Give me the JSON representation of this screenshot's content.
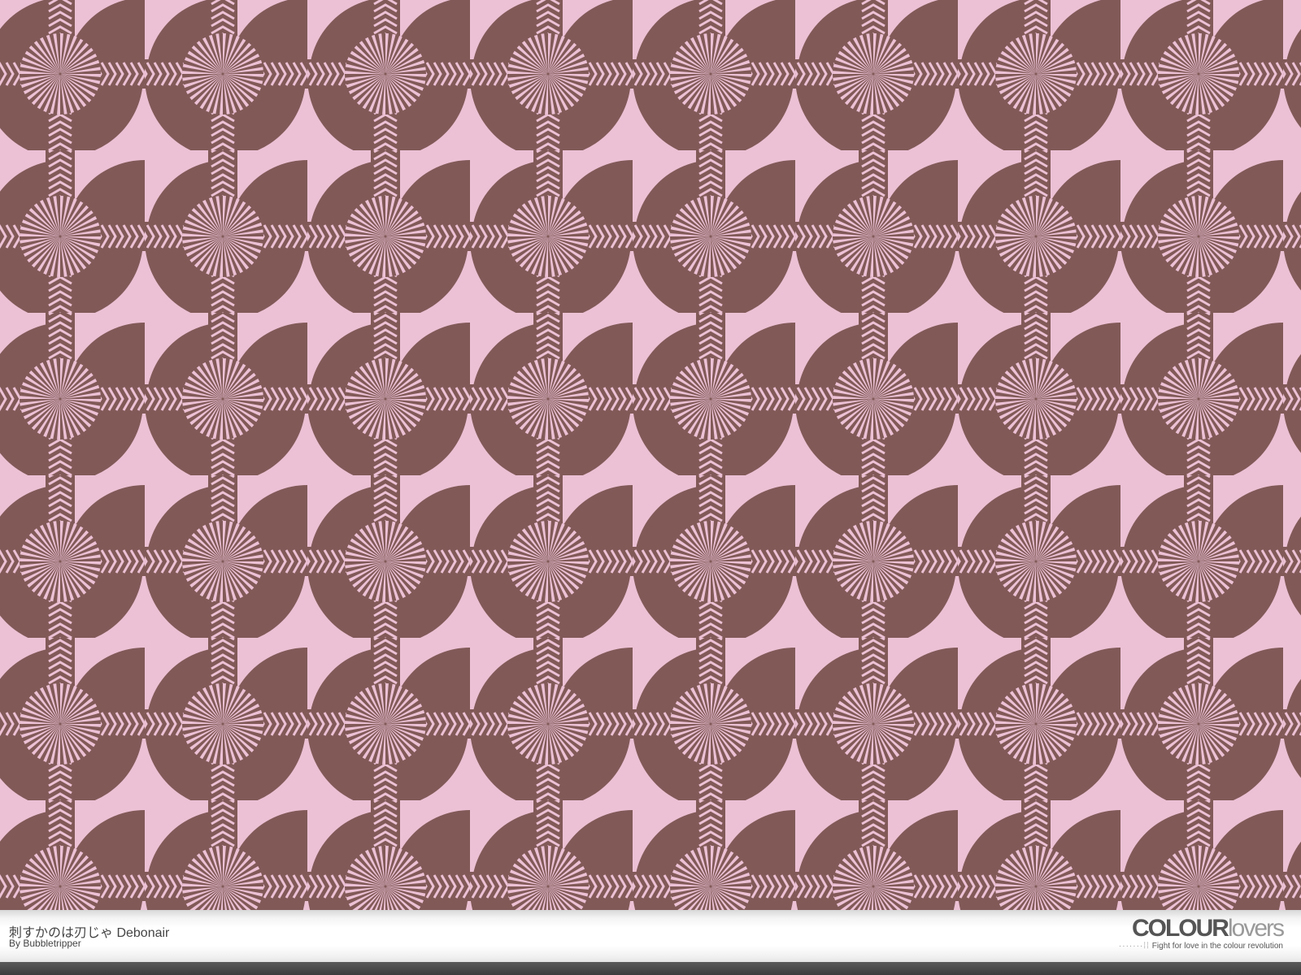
{
  "pattern": {
    "title": "刺すかのは刃じゃ Debonair",
    "author": "By Bubbletripper"
  },
  "brand": {
    "name_primary": "COLOUR",
    "name_secondary": "lovers",
    "tagline": "Fight for love in the colour revolution"
  },
  "colors": {
    "pattern_background": "#ecc1d5",
    "pattern_foreground": "#815a58"
  }
}
